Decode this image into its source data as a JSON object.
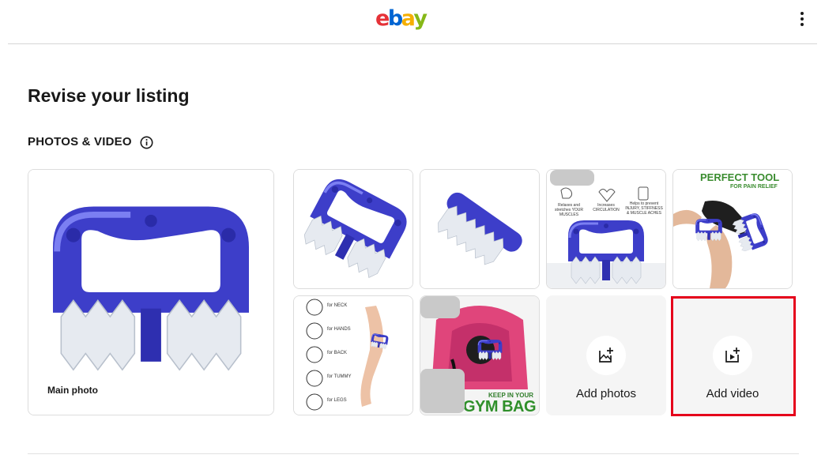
{
  "header": {
    "logo_letters": [
      "e",
      "b",
      "a",
      "y"
    ],
    "logo_colors": [
      "#e53238",
      "#0064d2",
      "#f5af02",
      "#86b817"
    ],
    "menu_icon": "more-vertical-icon"
  },
  "page": {
    "title": "Revise your listing",
    "section_title": "PHOTOS & VIDEO",
    "section_info_icon": "info-icon"
  },
  "photos": {
    "main_label": "Main photo",
    "tiles": [
      {
        "subject": "blue massage roller, side view"
      },
      {
        "subject": "blue massage roller, angled view"
      },
      {
        "subject": "roller benefits infographic",
        "captions": [
          "Relaxes and stretches YOUR MUSCLES",
          "Increases CIRCULATION",
          "Helps to prevent INJURY, STIFFNESS & MUSCLE ACHES"
        ]
      },
      {
        "subject": "roller used on leg",
        "headline": "PERFECT TOOL",
        "subline": "FOR PAIN RELIEF"
      },
      {
        "subject": "body areas chart",
        "areas": [
          "for NECK",
          "for HANDS",
          "for BACK",
          "for TUMMY",
          "for LEGS"
        ]
      },
      {
        "subject": "roller in gym bag",
        "headline_small": "KEEP IN YOUR",
        "headline": "GYM BAG"
      }
    ]
  },
  "actions": {
    "add_photos_label": "Add photos",
    "add_photos_icon": "add-image-icon",
    "add_video_label": "Add video",
    "add_video_icon": "add-video-icon",
    "highlight_color": "#e5001b"
  }
}
